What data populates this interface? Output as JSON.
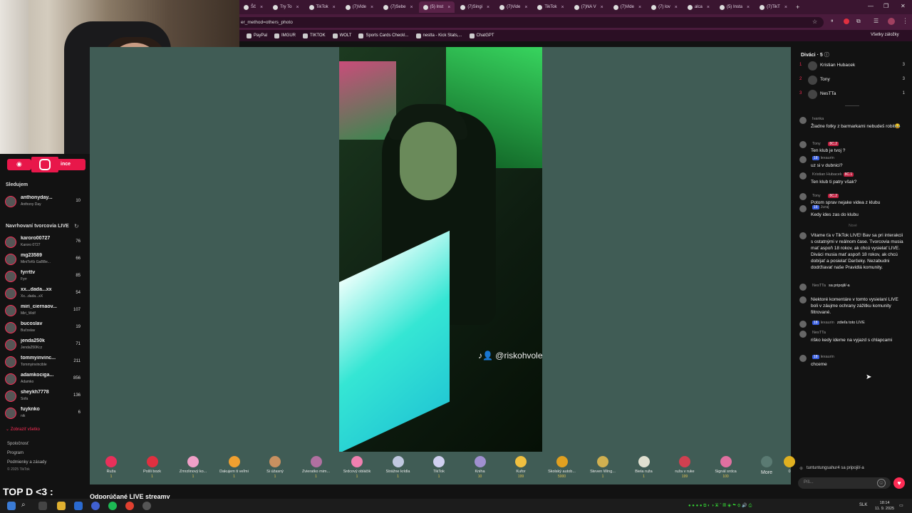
{
  "browser": {
    "tabs": [
      {
        "label": "Šč"
      },
      {
        "label": "Try To"
      },
      {
        "label": "TikTok"
      },
      {
        "label": "(7)Vide"
      },
      {
        "label": "(7)Sebe"
      },
      {
        "label": "(5) Inst"
      },
      {
        "label": "(7)Singi"
      },
      {
        "label": "(7)Vide"
      },
      {
        "label": "TikTok"
      },
      {
        "label": "(7)NA V"
      },
      {
        "label": "(7)Vide"
      },
      {
        "label": "(7) lov"
      },
      {
        "label": "alca"
      },
      {
        "label": "(5) Insta"
      },
      {
        "label": "(7)TikT"
      }
    ],
    "url": "er_method=others_photo",
    "bookmarks": [
      {
        "label": "PayPal"
      },
      {
        "label": "IMGUR"
      },
      {
        "label": "TIKTOK"
      },
      {
        "label": "WOLT"
      },
      {
        "label": "Sports Cards Checkl..."
      },
      {
        "label": "nestta - Kick Stats,..."
      },
      {
        "label": "ChatGPT"
      }
    ],
    "all_bookmarks": "Všetky záložky"
  },
  "sidebar": {
    "social_text": "ince",
    "following_title": "Sledujem",
    "following": [
      {
        "name": "anthonyday...",
        "sub": "Anthony Day",
        "count": "10"
      }
    ],
    "suggested_title": "Navrhovaní tvorcovia LIVE",
    "suggested": [
      {
        "name": "karoro00727",
        "sub": "Karoro 0727",
        "count": "76"
      },
      {
        "name": "mg23589",
        "sub": "MiniToKk GaBBe...",
        "count": "66"
      },
      {
        "name": "fyrrttv",
        "sub": "Fyrr",
        "count": "85"
      },
      {
        "name": "xx...dada...xx",
        "sub": "Xx...dada...xX",
        "count": "54"
      },
      {
        "name": "miri_ciernaov...",
        "sub": "Miri_Wolf",
        "count": "107"
      },
      {
        "name": "bucoslav",
        "sub": "Bučoslav",
        "count": "19"
      },
      {
        "name": "jenda250k",
        "sub": "Jenda250Kcz",
        "count": "71"
      },
      {
        "name": "tommyinvinc...",
        "sub": "Tommyinvincible",
        "count": "211"
      },
      {
        "name": "adamkociga...",
        "sub": "Adamko",
        "count": "856"
      },
      {
        "name": "sheykh7778",
        "sub": "Sofa",
        "count": "136"
      },
      {
        "name": "fuyknko",
        "sub": "nik",
        "count": "6"
      }
    ],
    "show_all": "Zobraziť všetko",
    "footer": [
      "Spoločnosť",
      "Program",
      "Podmienky a zásady",
      "© 2025 TikTok"
    ],
    "overlay_text": "TOP D <3 :"
  },
  "stage": {
    "watermark": "@riskohvole",
    "gifts": [
      {
        "name": "Ruža",
        "price": "1",
        "color": "#e8305a"
      },
      {
        "name": "Pošli bozk",
        "price": "1",
        "color": "#e03040"
      },
      {
        "name": "Zmrzlinový ko...",
        "price": "1",
        "color": "#f0a0c8"
      },
      {
        "name": "Ďakujem ti veľmi",
        "price": "1",
        "color": "#f0a030"
      },
      {
        "name": "Si úžasný",
        "price": "1",
        "color": "#c89060"
      },
      {
        "name": "Zvieratko mim...",
        "price": "1",
        "color": "#b070a0"
      },
      {
        "name": "Srdcový obláčik",
        "price": "1",
        "color": "#f080b0"
      },
      {
        "name": "Strážne krídla",
        "price": "1",
        "color": "#c0c8e0"
      },
      {
        "name": "TikTok",
        "price": "1",
        "color": "#d0d0f0"
      },
      {
        "name": "Kniha",
        "price": "10",
        "color": "#a090d0"
      },
      {
        "name": "Kufor",
        "price": "199",
        "color": "#f0c040"
      },
      {
        "name": "Školský autob...",
        "price": "5000",
        "color": "#e0a020"
      },
      {
        "name": "Steven Wing...",
        "price": "1",
        "color": "#d0b050"
      },
      {
        "name": "Biela ruža",
        "price": "1",
        "color": "#e0e0d0"
      },
      {
        "name": "ruža v ruke",
        "price": "199",
        "color": "#d04050"
      },
      {
        "name": "Signál srdca",
        "price": "100",
        "color": "#e070a0"
      }
    ],
    "more_label": "More",
    "coins_label": "0",
    "recommended": "Odporúčané LIVE streamy"
  },
  "chat": {
    "viewers_title": "Diváci · 5",
    "viewers": [
      {
        "rank": "1",
        "name": "Kristian Hubacek",
        "count": "3"
      },
      {
        "rank": "2",
        "name": "Tony",
        "count": "3"
      },
      {
        "rank": "3",
        "name": "NesTTa",
        "count": "1"
      }
    ],
    "messages": [
      {
        "user": "Ivanka",
        "badge": "",
        "text": "Žiadne fotky z barmarkami nebudeš robit😂"
      },
      {
        "user": "Tony",
        "badge": "8C.2",
        "text": "Ten klub je tvoj ?"
      },
      {
        "user": "lexaurin",
        "badge": "18",
        "text": "uz si v dubnici?"
      },
      {
        "user": "Kristian Hubacek",
        "badge": "8C.1",
        "text": "Ten klub ti patry však?"
      },
      {
        "user": "Tony",
        "badge": "8C.2",
        "text": "Potom sprav nejake videa z klubu"
      },
      {
        "user": "Juraj",
        "badge": "16",
        "text": "Kedy ides zas do klubu"
      },
      {
        "user": "Nové",
        "badge": "",
        "text": ""
      },
      {
        "user": "",
        "badge": "",
        "text": "Vitame ťa v TikTok LIVE! Bav sa pri interakcii s ostatnými v reálnom čase. Tvorcovia musia mať aspoň 18 rokov, ak chcú vysielať LIVE. Diváci musia mať aspoň 18 rokov, ak chcú dobíjať a posielať Darčeky. Nezabudni dodržiavať naše Pravidlá komunity."
      },
      {
        "user": "NesTTa",
        "badge": "",
        "text": "sa pripojil/-a"
      },
      {
        "user": "",
        "badge": "",
        "text": "Niektoré komentáre v tomto vysielaní LIVE boli v záujme ochrany zážitku komunity filtrované."
      },
      {
        "user": "lexaurin",
        "badge": "18",
        "text": "zdieľa toto LIVE"
      },
      {
        "user": "NesTTa",
        "badge": "",
        "text": "riško kedy ideme na vyjazd s chlapcami"
      },
      {
        "user": "lexaurin",
        "badge": "18",
        "text": "chceme"
      }
    ],
    "join_note": "tuntuntungsahur4 sa pripojil/-a",
    "input_placeholder": "Píš..."
  },
  "taskbar": {
    "time": "18:14",
    "date": "11. 9. 2025",
    "lang": "SLK"
  }
}
